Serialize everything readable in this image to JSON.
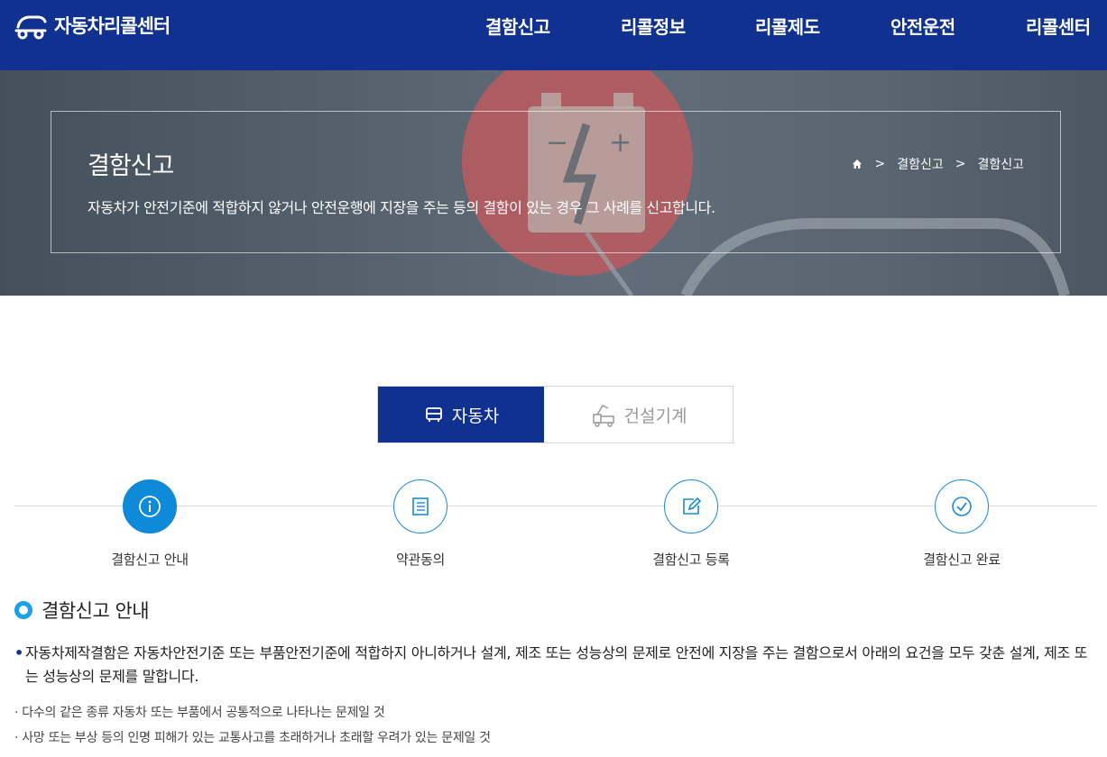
{
  "header": {
    "logo_text": "자동차리콜센터",
    "nav": [
      "결함신고",
      "리콜정보",
      "리콜제도",
      "안전운전",
      "리콜센터"
    ]
  },
  "hero": {
    "title": "결함신고",
    "description": "자동차가 안전기준에 적합하지 않거나 안전운행에 지장을 주는 등의 결함이 있는 경우 그 사례를 신고합니다.",
    "breadcrumb": [
      "결함신고",
      "결함신고"
    ]
  },
  "tabs": [
    {
      "label": "자동차",
      "icon": "car-icon",
      "active": true
    },
    {
      "label": "건설기계",
      "icon": "construction-machine-icon",
      "active": false
    }
  ],
  "steps": [
    {
      "label": "결함신고 안내",
      "icon": "info-icon",
      "active": true
    },
    {
      "label": "약관동의",
      "icon": "document-icon",
      "active": false
    },
    {
      "label": "결함신고 등록",
      "icon": "edit-icon",
      "active": false
    },
    {
      "label": "결함신고 완료",
      "icon": "check-icon",
      "active": false
    }
  ],
  "section": {
    "title": "결함신고 안내",
    "paragraph": "자동차제작결함은 자동차안전기준 또는 부품안전기준에 적합하지 아니하거나 설계, 제조 또는 성능상의 문제로 안전에 지장을 주는 결함으로서 아래의 요건을 모두 갖춘 설계, 제조 또는 성능상의 문제를 말합니다.",
    "items": [
      "· 다수의 같은 종류 자동차 또는 부품에서 공통적으로 나타나는 문제일 것",
      "· 사망 또는 부상 등의 인명 피해가 있는 교통사고를 초래하거나 초래할 우려가 있는 문제일 것"
    ]
  },
  "colors": {
    "brand_navy": "#10318f",
    "step_blue": "#0f8ad8",
    "section_dot": "#1aa0e8"
  }
}
